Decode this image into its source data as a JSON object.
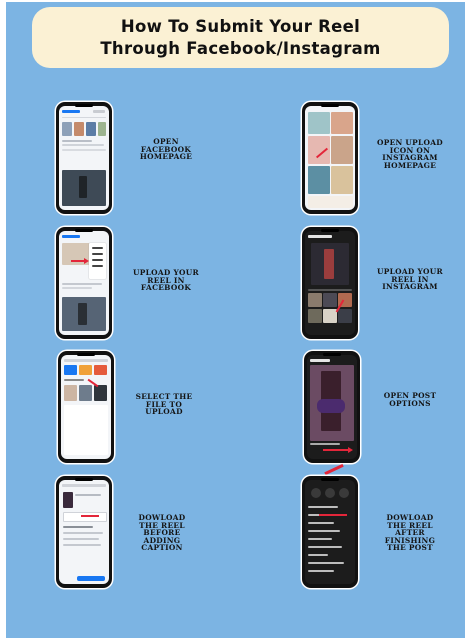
{
  "title": {
    "line1": "How To  Submit Your Reel",
    "line2": "Through Facebook/Instagram"
  },
  "steps_left": [
    {
      "label": "OPEN\nFACEBOOK\nHOMEPAGE",
      "app": "Facebook"
    },
    {
      "label": "UPLOAD  YOUR\nREEL IN\nFACEBOOK",
      "app": "Facebook"
    },
    {
      "label": "SELECT THE\nFILE TO\nUPLOAD",
      "app": "Facebook"
    },
    {
      "label": "DOWLOAD\nTHE REEL\nBEFORE\nADDING\nCAPTION",
      "app": "Facebook"
    }
  ],
  "steps_right": [
    {
      "label": "OPEN UPLOAD\nICON ON\nINSTAGRAM\nHOMEPAGE",
      "app": "Instagram"
    },
    {
      "label": "UPLOAD  YOUR\nREEL IN\nINSTAGRAM",
      "app": "Instagram"
    },
    {
      "label": "OPEN POST\nOPTIONS",
      "app": "Instagram"
    },
    {
      "label": "DOWLOAD\nTHE REEL\nAFTER\nFINISHING\nTHE POST",
      "app": "Instagram"
    }
  ],
  "colors": {
    "background": "#7cb4e3",
    "title_box": "#fbf1d4",
    "arrow": "#e3263a",
    "facebook_blue": "#1877f2"
  }
}
